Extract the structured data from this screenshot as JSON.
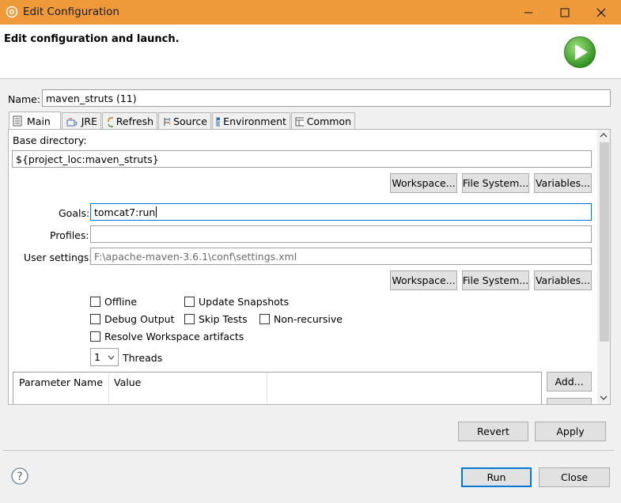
{
  "window": {
    "title": "Edit Configuration",
    "icon": "gear-icon"
  },
  "header": {
    "text": "Edit configuration and launch.",
    "icon": "run-launch-icon"
  },
  "name": {
    "label": "Name:",
    "value": "maven_struts (11)"
  },
  "tabs": [
    {
      "label": "Main",
      "icon": "main-tab-icon"
    },
    {
      "label": "JRE",
      "icon": "jre-icon"
    },
    {
      "label": "Refresh",
      "icon": "refresh-icon"
    },
    {
      "label": "Source",
      "icon": "source-icon"
    },
    {
      "label": "Environment",
      "icon": "environment-icon"
    },
    {
      "label": "Common",
      "icon": "common-icon"
    }
  ],
  "main": {
    "base_dir_label": "Base directory:",
    "base_dir_value": "${project_loc:maven_struts}",
    "workspace_label": "Workspace...",
    "file_system_label": "File System...",
    "variables_label": "Variables...",
    "goals_label": "Goals:",
    "goals_value": "tomcat7:run",
    "profiles_label": "Profiles:",
    "profiles_value": "",
    "user_settings_label": "User settings:",
    "user_settings_value": "F:\\apache-maven-3.6.1\\conf\\settings.xml",
    "offline_label": "Offline",
    "update_snapshots_label": "Update Snapshots",
    "debug_output_label": "Debug Output",
    "skip_tests_label": "Skip Tests",
    "non_recursive_label": "Non-recursive",
    "resolve_workspace_label": "Resolve Workspace artifacts",
    "threads_value": "1",
    "threads_label": "Threads",
    "param_col_name": "Parameter Name",
    "param_col_value": "Value",
    "add_label": "Add..."
  },
  "buttons": {
    "revert": "Revert",
    "apply": "Apply",
    "run": "Run",
    "close": "Close"
  }
}
